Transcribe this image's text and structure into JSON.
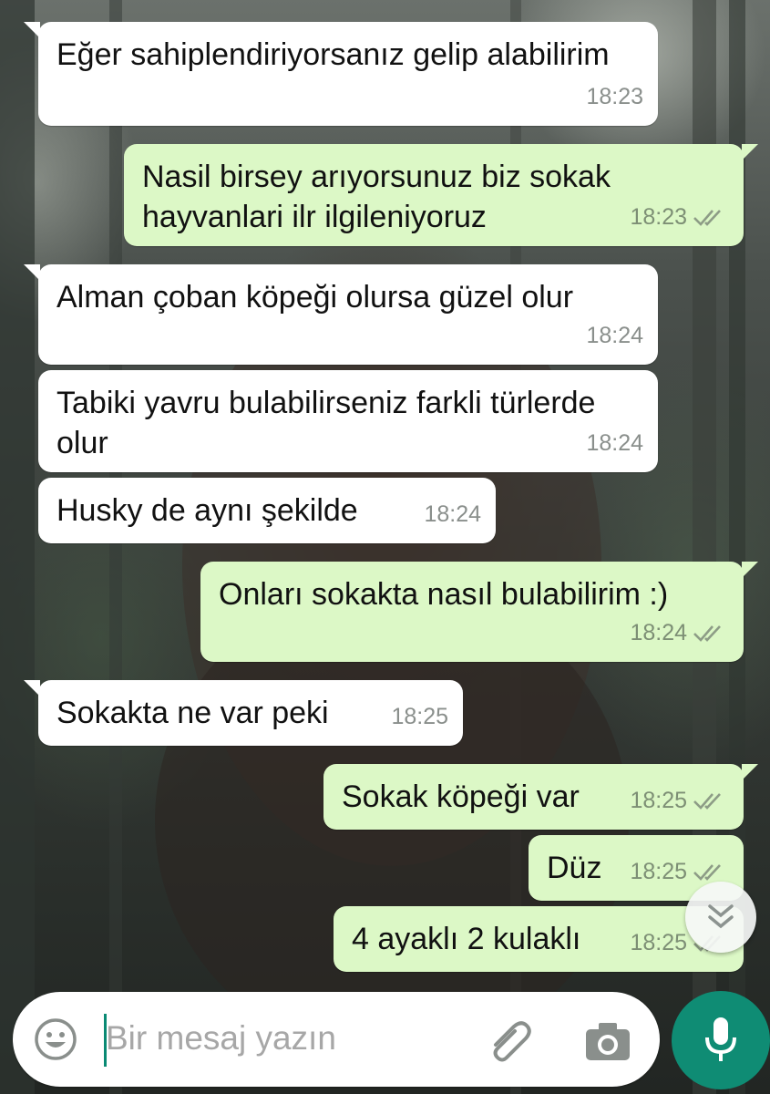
{
  "chat": {
    "messages": [
      {
        "direction": "in",
        "text": "Eğer sahiplendiriyorsanız gelip alabilirim",
        "time": "18:23"
      },
      {
        "direction": "out",
        "text": "Nasil birsey arıyorsunuz biz sokak hayvanlari ilr ilgileniyoruz",
        "time": "18:23",
        "status": "read-ticks"
      },
      {
        "direction": "in",
        "text": "Alman çoban köpeği olursa güzel olur",
        "time": "18:24"
      },
      {
        "direction": "in",
        "text": "Tabiki yavru bulabilirseniz farkli türlerde olur",
        "time": "18:24"
      },
      {
        "direction": "in",
        "text": "Husky de aynı şekilde",
        "time": "18:24"
      },
      {
        "direction": "out",
        "text": "Onları sokakta nasıl bulabilirim :)",
        "time": "18:24",
        "status": "read-ticks"
      },
      {
        "direction": "in",
        "text": "Sokakta ne var peki",
        "time": "18:25"
      },
      {
        "direction": "out",
        "text": "Sokak köpeği var",
        "time": "18:25",
        "status": "read-ticks"
      },
      {
        "direction": "out",
        "text": "Düz",
        "time": "18:25",
        "status": "read-ticks"
      },
      {
        "direction": "out",
        "text": "4 ayaklı 2 kulaklı",
        "time": "18:25",
        "status": "read-ticks"
      }
    ]
  },
  "composer": {
    "placeholder": "Bir mesaj yazın",
    "icons": [
      "emoji-icon",
      "attach-icon",
      "camera-icon",
      "mic-icon"
    ]
  },
  "scroll_down_icon": "double-chevron-down-icon",
  "colors": {
    "incoming_bubble": "#ffffff",
    "outgoing_bubble": "#dcf8c6",
    "accent": "#0f8c74",
    "timestamp": "#8a8f8c"
  }
}
